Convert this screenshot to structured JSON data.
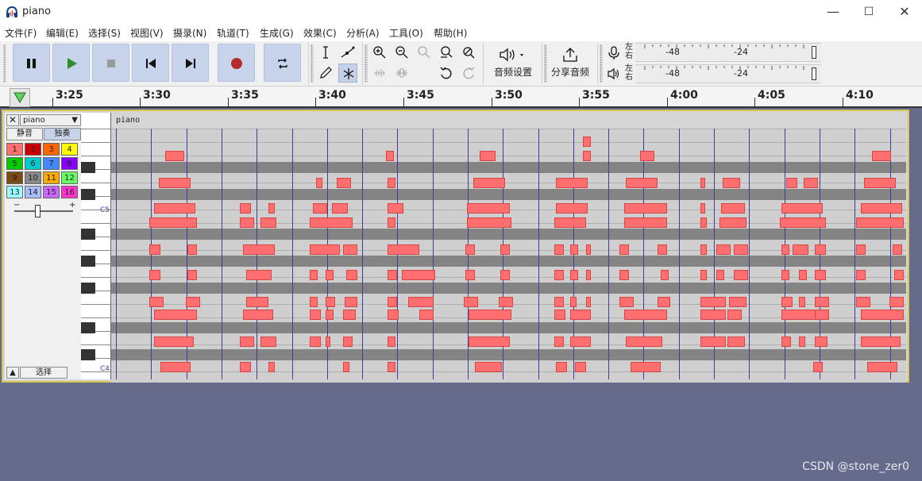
{
  "window": {
    "title": "piano",
    "min": "—",
    "max": "☐",
    "close": "✕"
  },
  "menu": [
    "文件(F)",
    "编辑(E)",
    "选择(S)",
    "视图(V)",
    "摄录(N)",
    "轨道(T)",
    "生成(G)",
    "效果(C)",
    "分析(A)",
    "工具(O)",
    "帮助(H)"
  ],
  "toolbar": {
    "audio_setup_label": "音频设置",
    "share_label": "分享音频",
    "meter_left_label": "左\n右",
    "meter_ticks": [
      "-48",
      "-24"
    ]
  },
  "ruler": {
    "labels": [
      "3:25",
      "3:30",
      "3:35",
      "3:40",
      "3:45",
      "3:50",
      "3:55",
      "4:00",
      "4:05",
      "4:10"
    ]
  },
  "track": {
    "name": "piano",
    "mute_label": "静音",
    "solo_label": "独奏",
    "select_label": "选择",
    "gain_minus": "−",
    "gain_plus": "+",
    "key_labels": [
      "C5",
      "C4"
    ],
    "clip_name": "piano",
    "channels": [
      {
        "n": "1",
        "c": "#ff6f6f"
      },
      {
        "n": "2",
        "c": "#cc0000"
      },
      {
        "n": "3",
        "c": "#ff6600"
      },
      {
        "n": "4",
        "c": "#ffff00"
      },
      {
        "n": "5",
        "c": "#00cc00"
      },
      {
        "n": "6",
        "c": "#00cccc"
      },
      {
        "n": "7",
        "c": "#4488ff"
      },
      {
        "n": "8",
        "c": "#8800ff"
      },
      {
        "n": "9",
        "c": "#7a4a18"
      },
      {
        "n": "10",
        "c": "#888888"
      },
      {
        "n": "11",
        "c": "#ffaa00"
      },
      {
        "n": "12",
        "c": "#66ff66"
      },
      {
        "n": "13",
        "c": "#99ffff"
      },
      {
        "n": "14",
        "c": "#aabbff"
      },
      {
        "n": "15",
        "c": "#cc66ff"
      },
      {
        "n": "16",
        "c": "#ff33cc"
      }
    ]
  },
  "watermark": "CSDN @stone_zer0"
}
